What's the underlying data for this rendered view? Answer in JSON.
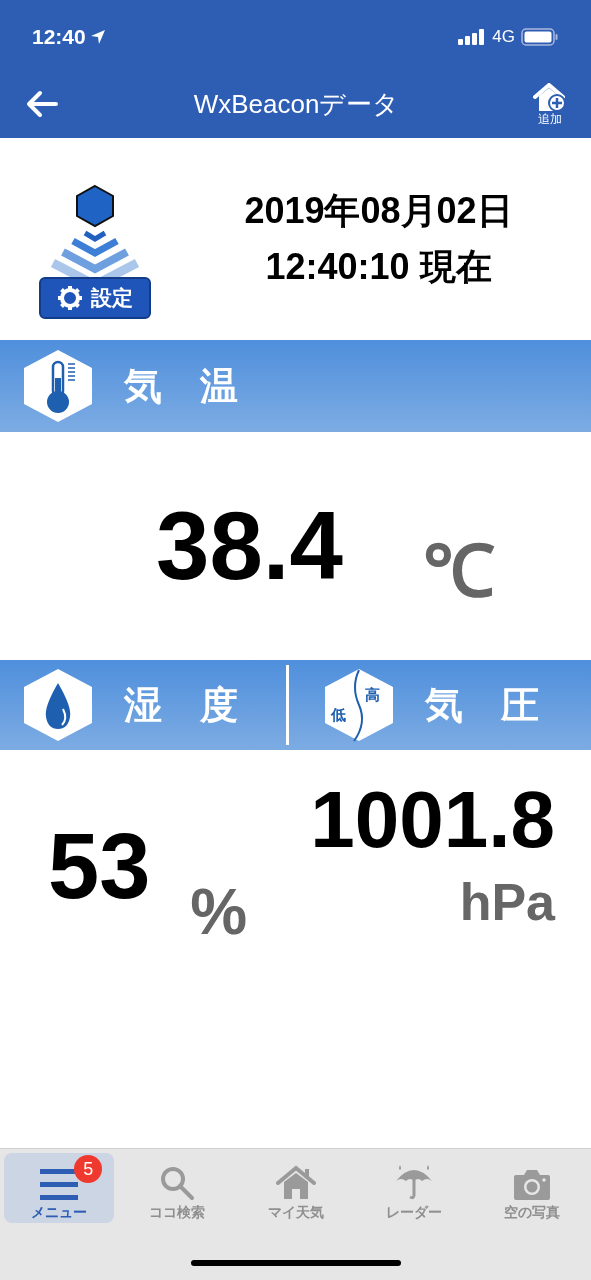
{
  "status_bar": {
    "time": "12:40",
    "network": "4G"
  },
  "nav": {
    "title": "WxBeaconデータ",
    "add_label": "追加"
  },
  "info": {
    "settings_label": "設定",
    "date": "2019年08月02日",
    "time": "12:40:10 現在"
  },
  "temperature": {
    "label": "気　温",
    "value": "38.4",
    "unit": "℃"
  },
  "humidity": {
    "label": "湿　度",
    "value": "53",
    "unit": "%"
  },
  "pressure": {
    "label": "気　圧",
    "low": "低",
    "high": "高",
    "value": "1001.8",
    "unit": "hPa"
  },
  "tabs": [
    {
      "kind": "menu",
      "label": "メニュー",
      "selected": true,
      "badge": "5"
    },
    {
      "kind": "search",
      "label": "ココ検索",
      "selected": false
    },
    {
      "kind": "home",
      "label": "マイ天気",
      "selected": false
    },
    {
      "kind": "radar",
      "label": "レーダー",
      "selected": false
    },
    {
      "kind": "camera",
      "label": "空の写真",
      "selected": false
    }
  ]
}
